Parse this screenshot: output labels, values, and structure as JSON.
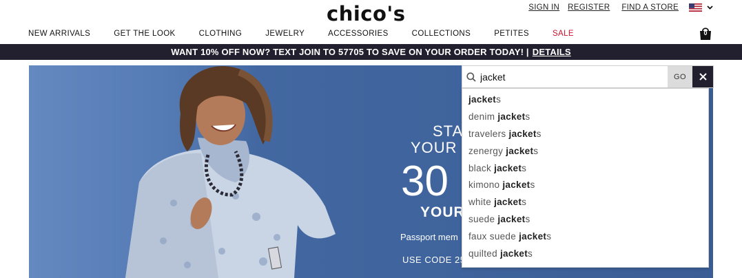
{
  "brand": {
    "logo_text": "chico's"
  },
  "utility": {
    "sign_in": "SIGN IN",
    "register": "REGISTER",
    "find_store": "FIND A STORE",
    "flag_icon": "us-flag-icon"
  },
  "nav": {
    "items": [
      "NEW ARRIVALS",
      "GET THE LOOK",
      "CLOTHING",
      "JEWELRY",
      "ACCESSORIES",
      "COLLECTIONS",
      "PETITES",
      "SALE"
    ],
    "bag_count": "0"
  },
  "promo": {
    "text": "WANT 10% OFF NOW? TEXT JOIN TO 57705 TO SAVE ON YOUR ORDER TODAY! |",
    "details": "DETAILS"
  },
  "hero": {
    "line1": "STA",
    "line2": "YOUR T",
    "big": "30",
    "line3": "YOUR",
    "passport": "Passport mem",
    "code": "USE CODE 25"
  },
  "search": {
    "value": "jacket",
    "go_label": "GO",
    "suggestions": [
      {
        "pre": "",
        "match": "jacket",
        "post": "s"
      },
      {
        "pre": "denim ",
        "match": "jacket",
        "post": "s"
      },
      {
        "pre": "travelers ",
        "match": "jacket",
        "post": "s"
      },
      {
        "pre": "zenergy ",
        "match": "jacket",
        "post": "s"
      },
      {
        "pre": "black ",
        "match": "jacket",
        "post": "s"
      },
      {
        "pre": "kimono ",
        "match": "jacket",
        "post": "s"
      },
      {
        "pre": "white ",
        "match": "jacket",
        "post": "s"
      },
      {
        "pre": "suede ",
        "match": "jacket",
        "post": "s"
      },
      {
        "pre": "faux suede ",
        "match": "jacket",
        "post": "s"
      },
      {
        "pre": "quilted ",
        "match": "jacket",
        "post": "s"
      }
    ]
  },
  "colors": {
    "navy": "#22202f",
    "sale_red": "#c8102e",
    "hero_blue": "#4a6fa8"
  }
}
